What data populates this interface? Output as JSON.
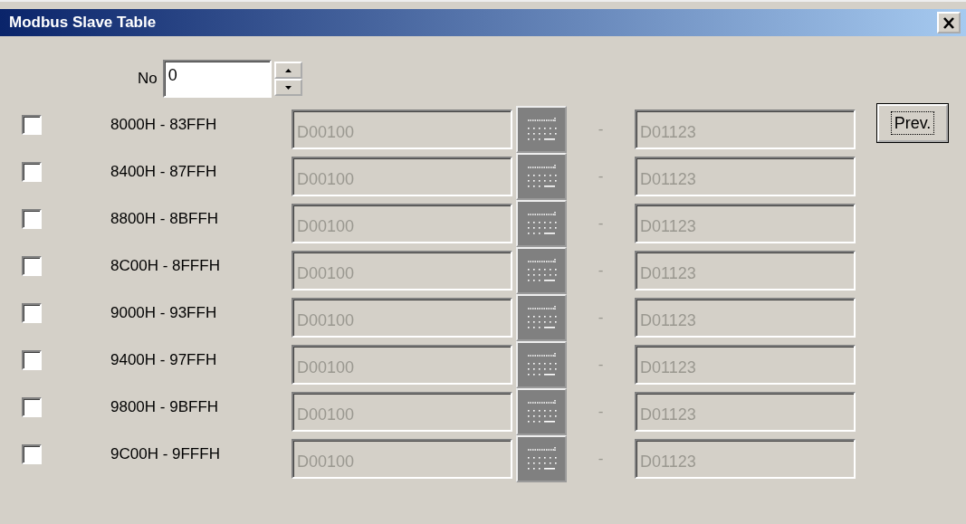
{
  "window": {
    "title": "Modbus Slave Table"
  },
  "no_field": {
    "label": "No",
    "value": "0"
  },
  "prev_button": "Prev.",
  "rows": [
    {
      "checked": false,
      "range": "8000H - 83FFH",
      "start": "D00100",
      "separator": "-",
      "end": "D01123",
      "disabled": true
    },
    {
      "checked": false,
      "range": "8400H - 87FFH",
      "start": "D00100",
      "separator": "-",
      "end": "D01123",
      "disabled": true
    },
    {
      "checked": false,
      "range": "8800H - 8BFFH",
      "start": "D00100",
      "separator": "-",
      "end": "D01123",
      "disabled": true
    },
    {
      "checked": false,
      "range": "8C00H - 8FFFH",
      "start": "D00100",
      "separator": "-",
      "end": "D01123",
      "disabled": true
    },
    {
      "checked": false,
      "range": "9000H - 93FFH",
      "start": "D00100",
      "separator": "-",
      "end": "D01123",
      "disabled": true
    },
    {
      "checked": false,
      "range": "9400H - 97FFH",
      "start": "D00100",
      "separator": "-",
      "end": "D01123",
      "disabled": true
    },
    {
      "checked": false,
      "range": "9800H - 9BFFH",
      "start": "D00100",
      "separator": "-",
      "end": "D01123",
      "disabled": true
    },
    {
      "checked": false,
      "range": "9C00H - 9FFFH",
      "start": "D00100",
      "separator": "-",
      "end": "D01123",
      "disabled": true
    }
  ]
}
